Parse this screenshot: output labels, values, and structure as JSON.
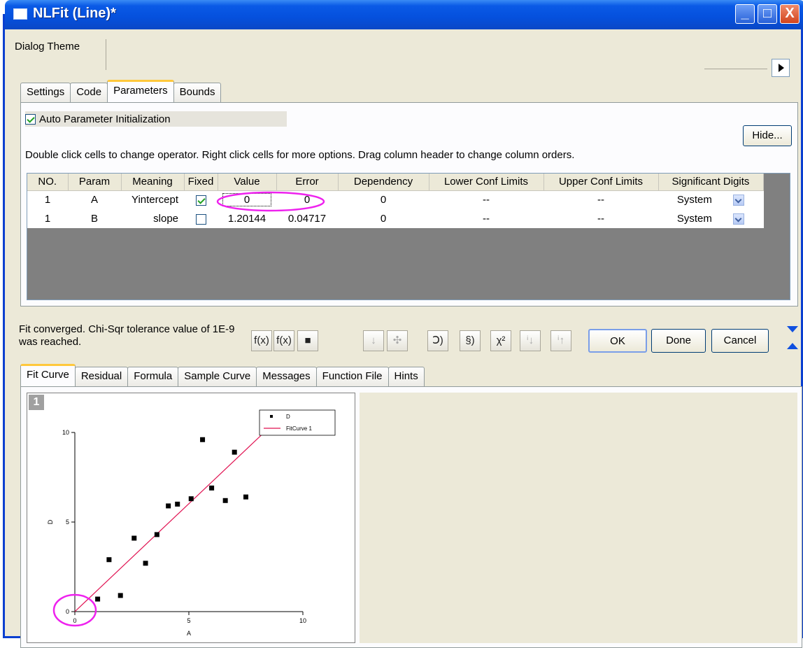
{
  "window": {
    "title": "NLFit (Line)*",
    "minimize": "_",
    "maximize": "□",
    "close": "X"
  },
  "theme": {
    "label": "Dialog Theme"
  },
  "top_tabs": [
    "Settings",
    "Code",
    "Parameters",
    "Bounds"
  ],
  "params": {
    "auto_init_label": "Auto Parameter Initialization",
    "auto_init_checked": true,
    "hide_button": "Hide...",
    "hint": "Double click cells to change operator. Right click cells for more options. Drag column header to change column orders.",
    "columns": [
      "NO.",
      "Param",
      "Meaning",
      "Fixed",
      "Value",
      "Error",
      "Dependency",
      "Lower Conf Limits",
      "Upper Conf Limits",
      "Significant Digits"
    ],
    "rows": [
      {
        "no": "1",
        "param": "A",
        "meaning": "Yintercept",
        "fixed": true,
        "value": "0",
        "error": "0",
        "dependency": "0",
        "lower": "--",
        "upper": "--",
        "digits": "System"
      },
      {
        "no": "1",
        "param": "B",
        "meaning": "slope",
        "fixed": false,
        "value": "1.20144",
        "error": "0.04717",
        "dependency": "0",
        "lower": "--",
        "upper": "--",
        "digits": "System"
      }
    ]
  },
  "status": {
    "text": "Fit converged. Chi-Sqr tolerance value of 1E-9 was reached."
  },
  "toolbar": {
    "icons": [
      "f(x)-wizard-icon",
      "function-icon",
      "save-icon",
      "sort-icon",
      "fit-until-converged-icon",
      "one-iteration-icon",
      "undo-icon",
      "chi-square-icon",
      "param-prev-icon",
      "param-next-icon"
    ],
    "labels": {
      "fx1": "f(x)",
      "fx2": "f(x)",
      "save": "■",
      "sort": "↓",
      "conv": "✣",
      "iter": "Ↄ)",
      "undo": "§)",
      "chi": "χ²",
      "p1": "ⁱ↓",
      "p2": "ⁱ↑"
    },
    "ok": "OK",
    "done": "Done",
    "cancel": "Cancel"
  },
  "bottom_tabs": [
    "Fit Curve",
    "Residual",
    "Formula",
    "Sample Curve",
    "Messages",
    "Function File",
    "Hints"
  ],
  "preview": {
    "layer_label": "1"
  },
  "chart_data": {
    "type": "scatter",
    "xlabel": "A",
    "ylabel": "D",
    "xlim": [
      0,
      10
    ],
    "ylim": [
      0,
      10
    ],
    "xticks": [
      "0",
      "5",
      "10"
    ],
    "yticks": [
      "0",
      "5",
      "10"
    ],
    "series": [
      {
        "name": "D",
        "kind": "points",
        "x": [
          1.0,
          1.5,
          2.0,
          2.6,
          3.1,
          3.6,
          4.1,
          4.5,
          5.1,
          5.6,
          6.0,
          6.6,
          7.0,
          7.5
        ],
        "y": [
          0.7,
          2.9,
          0.9,
          4.1,
          2.7,
          4.3,
          5.9,
          6.0,
          6.3,
          9.6,
          6.9,
          6.2,
          8.9,
          6.4
        ]
      },
      {
        "name": "FitCurve 1",
        "kind": "line",
        "color": "#e01050",
        "x": [
          0,
          8.3
        ],
        "y": [
          0,
          10
        ]
      }
    ]
  }
}
